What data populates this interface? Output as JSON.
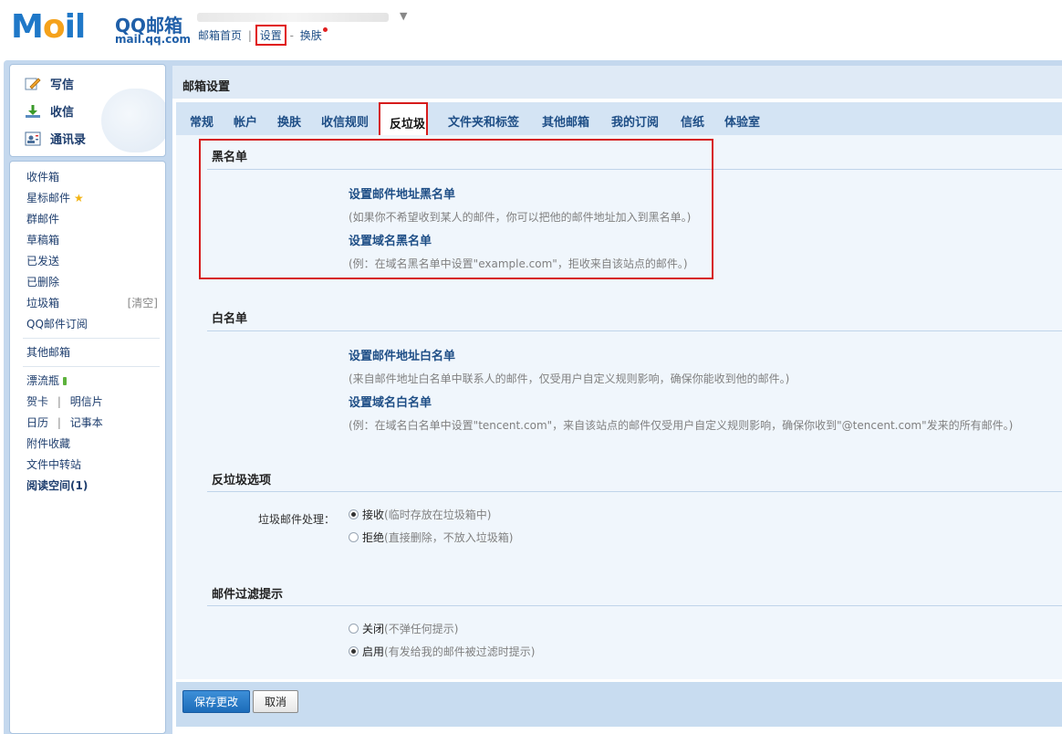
{
  "logo": {
    "word_prefix": "M",
    "word_o": "o",
    "word_suffix": "il",
    "qq": "QQ邮箱",
    "url": "mail.qq.com"
  },
  "top_links": {
    "home": "邮箱首页",
    "settings": "设置",
    "skin": "换肤",
    "separator": "|",
    "separator2": "-"
  },
  "quick": {
    "compose": "写信",
    "inbox": "收信",
    "contacts": "通讯录"
  },
  "nav": {
    "inbox": "收件箱",
    "starred": "星标邮件",
    "group": "群邮件",
    "drafts": "草稿箱",
    "sent": "已发送",
    "deleted": "已删除",
    "junk": "垃圾箱",
    "clear": "[清空]",
    "subscription": "QQ邮件订阅",
    "other_mail": "其他邮箱",
    "bottle": "漂流瓶",
    "card": "贺卡",
    "postcard": "明信片",
    "calendar": "日历",
    "notes": "记事本",
    "attachments": "附件收藏",
    "file_transfer": "文件中转站",
    "reading": "阅读空间(1)",
    "sep": "|"
  },
  "main": {
    "title": "邮箱设置",
    "tabs": [
      "常规",
      "帐户",
      "换肤",
      "收信规则",
      "反垃圾",
      "文件夹和标签",
      "其他邮箱",
      "我的订阅",
      "信纸",
      "体验室"
    ],
    "active_tab": "反垃圾"
  },
  "blacklist": {
    "title": "黑名单",
    "address_link": "设置邮件地址黑名单",
    "address_desc": "(如果你不希望收到某人的邮件，你可以把他的邮件地址加入到黑名单。)",
    "domain_link": "设置域名黑名单",
    "domain_desc": "(例：在域名黑名单中设置\"example.com\"，拒收来自该站点的邮件。)"
  },
  "whitelist": {
    "title": "白名单",
    "address_link": "设置邮件地址白名单",
    "address_desc": "(来自邮件地址白名单中联系人的邮件，仅受用户自定义规则影响，确保你能收到他的邮件。)",
    "domain_link": "设置域名白名单",
    "domain_desc": "(例：在域名白名单中设置\"tencent.com\"，来自该站点的邮件仅受用户自定义规则影响，确保你收到\"@tencent.com\"发来的所有邮件。)"
  },
  "antispam": {
    "title": "反垃圾选项",
    "label": "垃圾邮件处理：",
    "accept": "接收",
    "accept_hint": "(临时存放在垃圾箱中)",
    "accept_checked": true,
    "reject": "拒绝",
    "reject_hint": "(直接删除，不放入垃圾箱)",
    "reject_checked": false
  },
  "filter": {
    "title": "邮件过滤提示",
    "off": "关闭",
    "off_hint": "(不弹任何提示)",
    "off_checked": false,
    "on": "启用",
    "on_hint": "(有发给我的邮件被过滤时提示)",
    "on_checked": true
  },
  "footer": {
    "save": "保存更改",
    "cancel": "取消"
  },
  "colors": {
    "accent": "#1e4e86",
    "highlight_box": "#d61b1b",
    "frame": "#c4d8ee",
    "content_bg": "#f0f6fc"
  }
}
